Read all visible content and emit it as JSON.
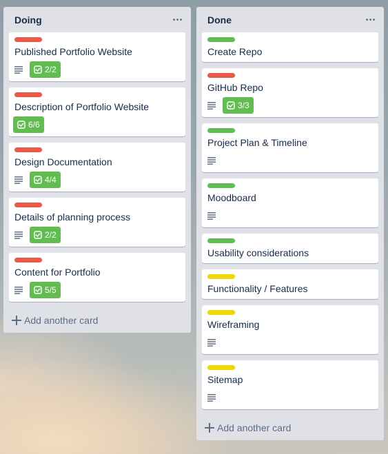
{
  "lists": [
    {
      "title": "Doing",
      "add_card_label": "Add another card",
      "cards": [
        {
          "title": "Published Portfolio Website",
          "label_color": "#eb5a46",
          "has_description": true,
          "checklist": "2/2"
        },
        {
          "title": "Description of Portfolio Website",
          "label_color": "#eb5a46",
          "has_description": false,
          "checklist": "6/6"
        },
        {
          "title": "Design Documentation",
          "label_color": "#eb5a46",
          "has_description": true,
          "checklist": "4/4"
        },
        {
          "title": "Details of planning process",
          "label_color": "#eb5a46",
          "has_description": true,
          "checklist": "2/2"
        },
        {
          "title": "Content for Portfolio",
          "label_color": "#eb5a46",
          "has_description": true,
          "checklist": "5/5"
        }
      ]
    },
    {
      "title": "Done",
      "add_card_label": "Add another card",
      "cards": [
        {
          "title": "Create Repo",
          "label_color": "#61bd4f",
          "has_description": false,
          "checklist": null
        },
        {
          "title": "GitHub Repo",
          "label_color": "#eb5a46",
          "has_description": true,
          "checklist": "3/3"
        },
        {
          "title": "Project Plan & Timeline",
          "label_color": "#61bd4f",
          "has_description": true,
          "checklist": null
        },
        {
          "title": "Moodboard",
          "label_color": "#61bd4f",
          "has_description": true,
          "checklist": null
        },
        {
          "title": "Usability considerations",
          "label_color": "#61bd4f",
          "has_description": false,
          "checklist": null
        },
        {
          "title": "Functionality / Features",
          "label_color": "#f2d600",
          "has_description": false,
          "checklist": null
        },
        {
          "title": "Wireframing",
          "label_color": "#f2d600",
          "has_description": true,
          "checklist": null
        },
        {
          "title": "Sitemap",
          "label_color": "#f2d600",
          "has_description": true,
          "checklist": null
        }
      ]
    }
  ],
  "icons": {
    "menu": "more-horizontal-icon",
    "description": "description-lines-icon",
    "checklist": "checkbox-icon",
    "add": "plus-icon"
  }
}
